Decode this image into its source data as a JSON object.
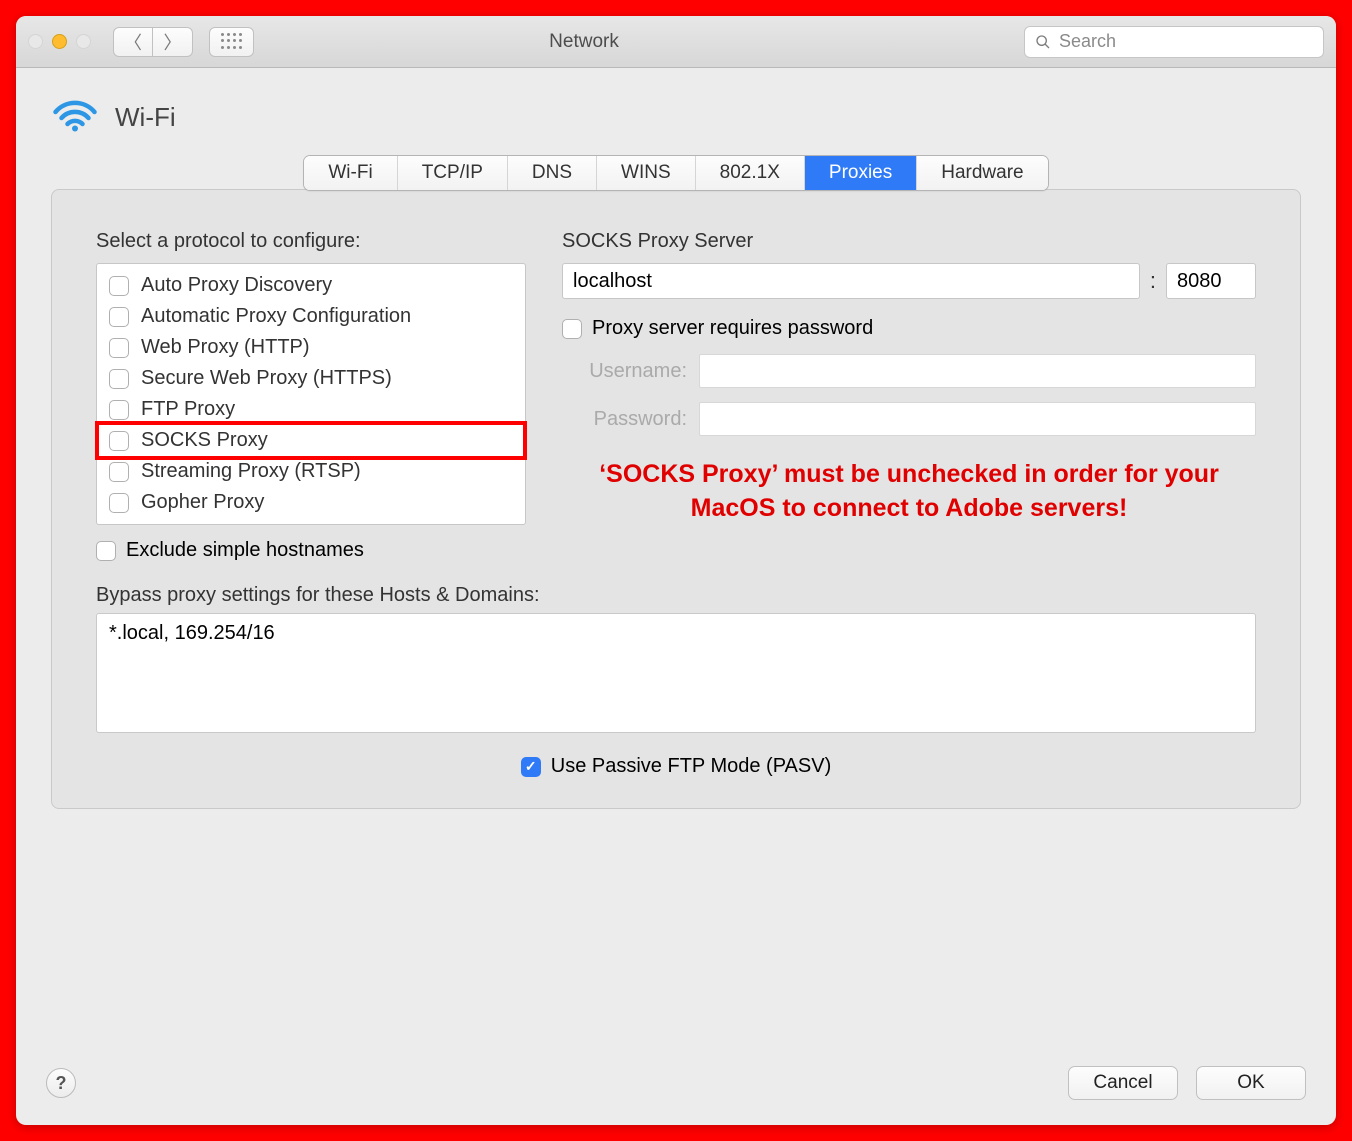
{
  "window": {
    "title": "Network",
    "search_placeholder": "Search"
  },
  "section": {
    "title": "Wi-Fi"
  },
  "tabs": {
    "items": [
      "Wi-Fi",
      "TCP/IP",
      "DNS",
      "WINS",
      "802.1X",
      "Proxies",
      "Hardware"
    ],
    "active_index": 5
  },
  "left": {
    "protocol_label": "Select a protocol to configure:",
    "protocols": [
      {
        "label": "Auto Proxy Discovery",
        "checked": false
      },
      {
        "label": "Automatic Proxy Configuration",
        "checked": false
      },
      {
        "label": "Web Proxy (HTTP)",
        "checked": false
      },
      {
        "label": "Secure Web Proxy (HTTPS)",
        "checked": false
      },
      {
        "label": "FTP Proxy",
        "checked": false
      },
      {
        "label": "SOCKS Proxy",
        "checked": false,
        "highlighted": true
      },
      {
        "label": "Streaming Proxy (RTSP)",
        "checked": false
      },
      {
        "label": "Gopher Proxy",
        "checked": false
      }
    ],
    "exclude_label": "Exclude simple hostnames",
    "exclude_checked": false
  },
  "right": {
    "server_label": "SOCKS Proxy Server",
    "host": "localhost",
    "port": "8080",
    "requires_password_label": "Proxy server requires password",
    "requires_password_checked": false,
    "username_label": "Username:",
    "username_value": "",
    "password_label": "Password:",
    "password_value": "",
    "annotation": "‘SOCKS Proxy’ must be unchecked in order for your MacOS to connect to Adobe servers!"
  },
  "bypass": {
    "label": "Bypass proxy settings for these Hosts & Domains:",
    "value": "*.local, 169.254/16"
  },
  "pasv": {
    "label": "Use Passive FTP Mode (PASV)",
    "checked": true
  },
  "footer": {
    "help": "?",
    "cancel": "Cancel",
    "ok": "OK"
  }
}
